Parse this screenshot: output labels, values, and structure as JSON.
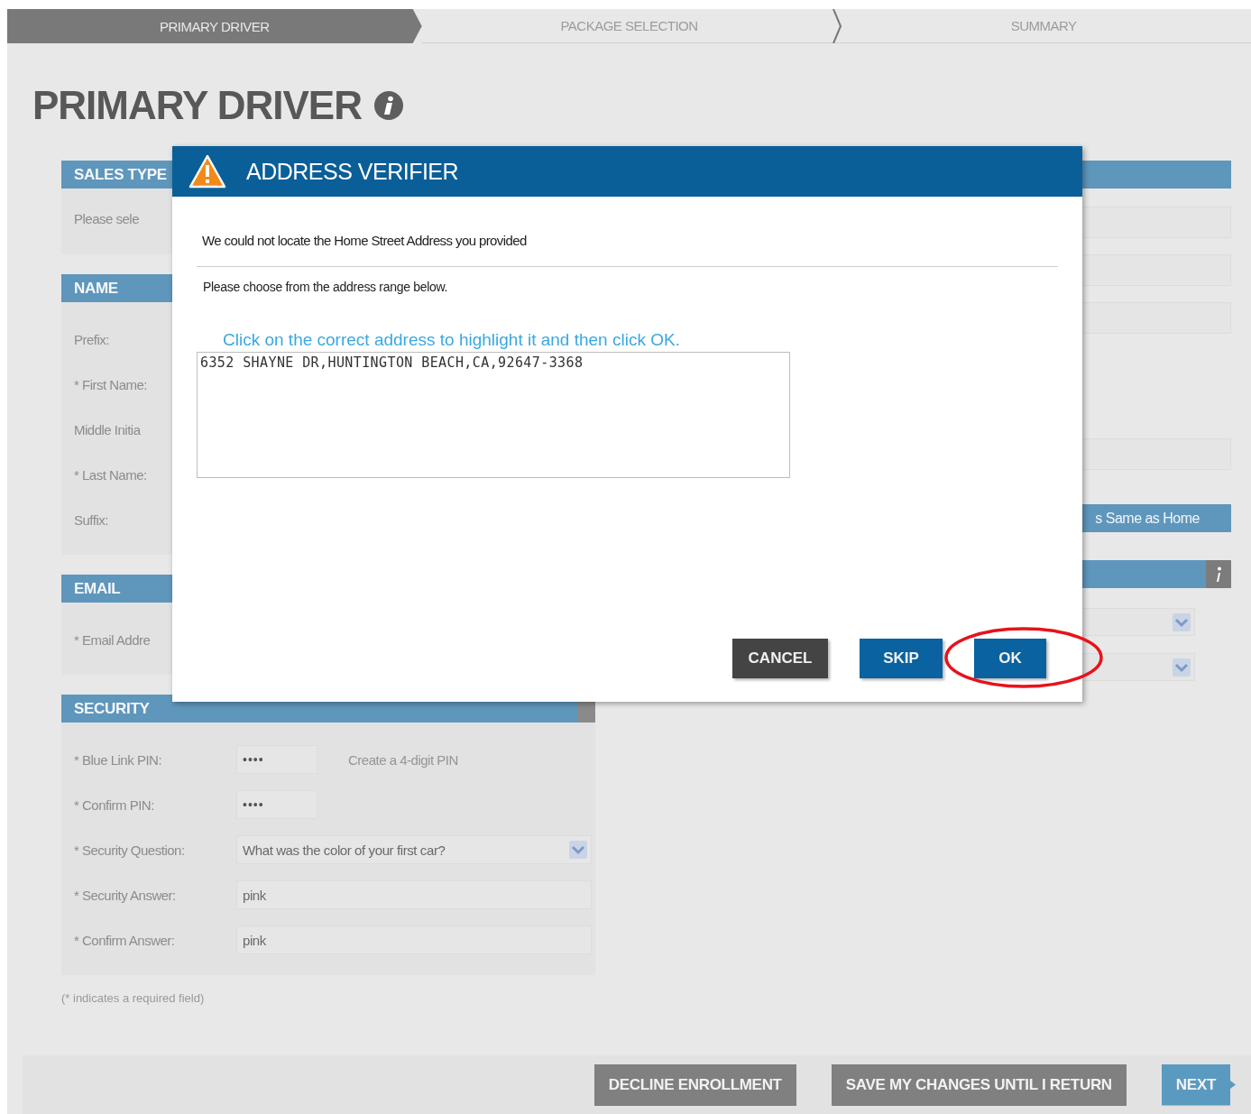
{
  "steps": [
    {
      "label": "PRIMARY DRIVER",
      "selected": true
    },
    {
      "label": "PACKAGE SELECTION",
      "selected": false
    },
    {
      "label": "SUMMARY",
      "selected": false
    }
  ],
  "title": "PRIMARY DRIVER",
  "sections": [
    {
      "title": "SALES TYPE",
      "rows": [
        {
          "kind": "label",
          "label": "Please sele"
        }
      ]
    },
    {
      "title": "NAME",
      "rows": [
        {
          "kind": "label",
          "label": "Prefix:"
        },
        {
          "kind": "label",
          "label": "* First Name:"
        },
        {
          "kind": "label",
          "label": "Middle Initia"
        },
        {
          "kind": "label",
          "label": "* Last Name:"
        },
        {
          "kind": "label",
          "label": "Suffix:"
        }
      ]
    },
    {
      "title": "EMAIL",
      "rows": [
        {
          "kind": "label",
          "label": "* Email Addre"
        }
      ]
    },
    {
      "title": "SECURITY",
      "info_tab": true,
      "rows": [
        {
          "kind": "password",
          "label": "* Blue Link PIN:",
          "value": "••••",
          "hint": "Create a 4-digit PIN"
        },
        {
          "kind": "password",
          "label": "* Confirm PIN:",
          "value": "••••"
        },
        {
          "kind": "select",
          "label": "* Security Question:",
          "value": "What was the color of your first car?"
        },
        {
          "kind": "text",
          "label": "* Security Answer:",
          "value": "pink"
        },
        {
          "kind": "text",
          "label": "* Confirm Answer:",
          "value": "pink"
        }
      ]
    }
  ],
  "note": "(* indicates a required field)",
  "right_panel": {
    "mailing_bar": "s Same as Home"
  },
  "modal": {
    "title": "ADDRESS VERIFIER",
    "message": "We could not locate the Home Street Address you provided",
    "instruction": "Please choose from the address range below.",
    "hint": "Click on the correct address to highlight it and then click OK.",
    "addresses": [
      {
        "text": "6352 SHAYNE DR,HUNTINGTON BEACH,CA,92647-3368",
        "selected": false
      }
    ],
    "buttons": [
      {
        "label": "CANCEL",
        "kind": "dark",
        "circled": false
      },
      {
        "label": "SKIP",
        "kind": "primary",
        "circled": false
      },
      {
        "label": "OK",
        "kind": "primary",
        "circled": true
      }
    ]
  },
  "footer_buttons": [
    {
      "label": "DECLINE ENROLLMENT",
      "kind": "secondary"
    },
    {
      "label": "SAVE MY CHANGES UNTIL I RETURN",
      "kind": "secondary"
    },
    {
      "label": "NEXT",
      "kind": "next"
    }
  ]
}
